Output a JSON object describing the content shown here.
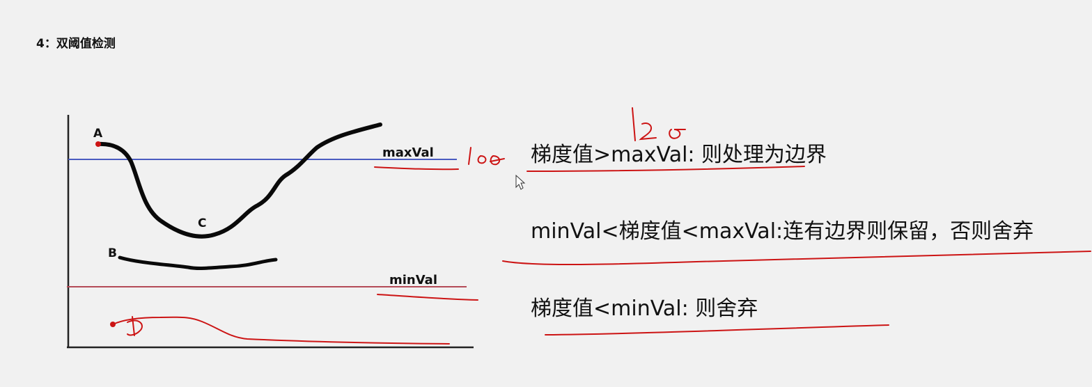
{
  "heading": "4：双阈值检测",
  "diagram": {
    "max_label": "maxVal",
    "min_label": "minVal",
    "point_a": "A",
    "point_b": "B",
    "point_c": "C"
  },
  "rules": [
    "梯度值>maxVal: 则处理为边界",
    "minVal<梯度值<maxVal:连有边界则保留，否则舍弃",
    "梯度值<minVal: 则舍弃"
  ],
  "colors": {
    "max_line": "#4a5bc0",
    "min_line": "#b44a57",
    "annotation": "#cc1414",
    "curve": "#0a0a0a"
  }
}
